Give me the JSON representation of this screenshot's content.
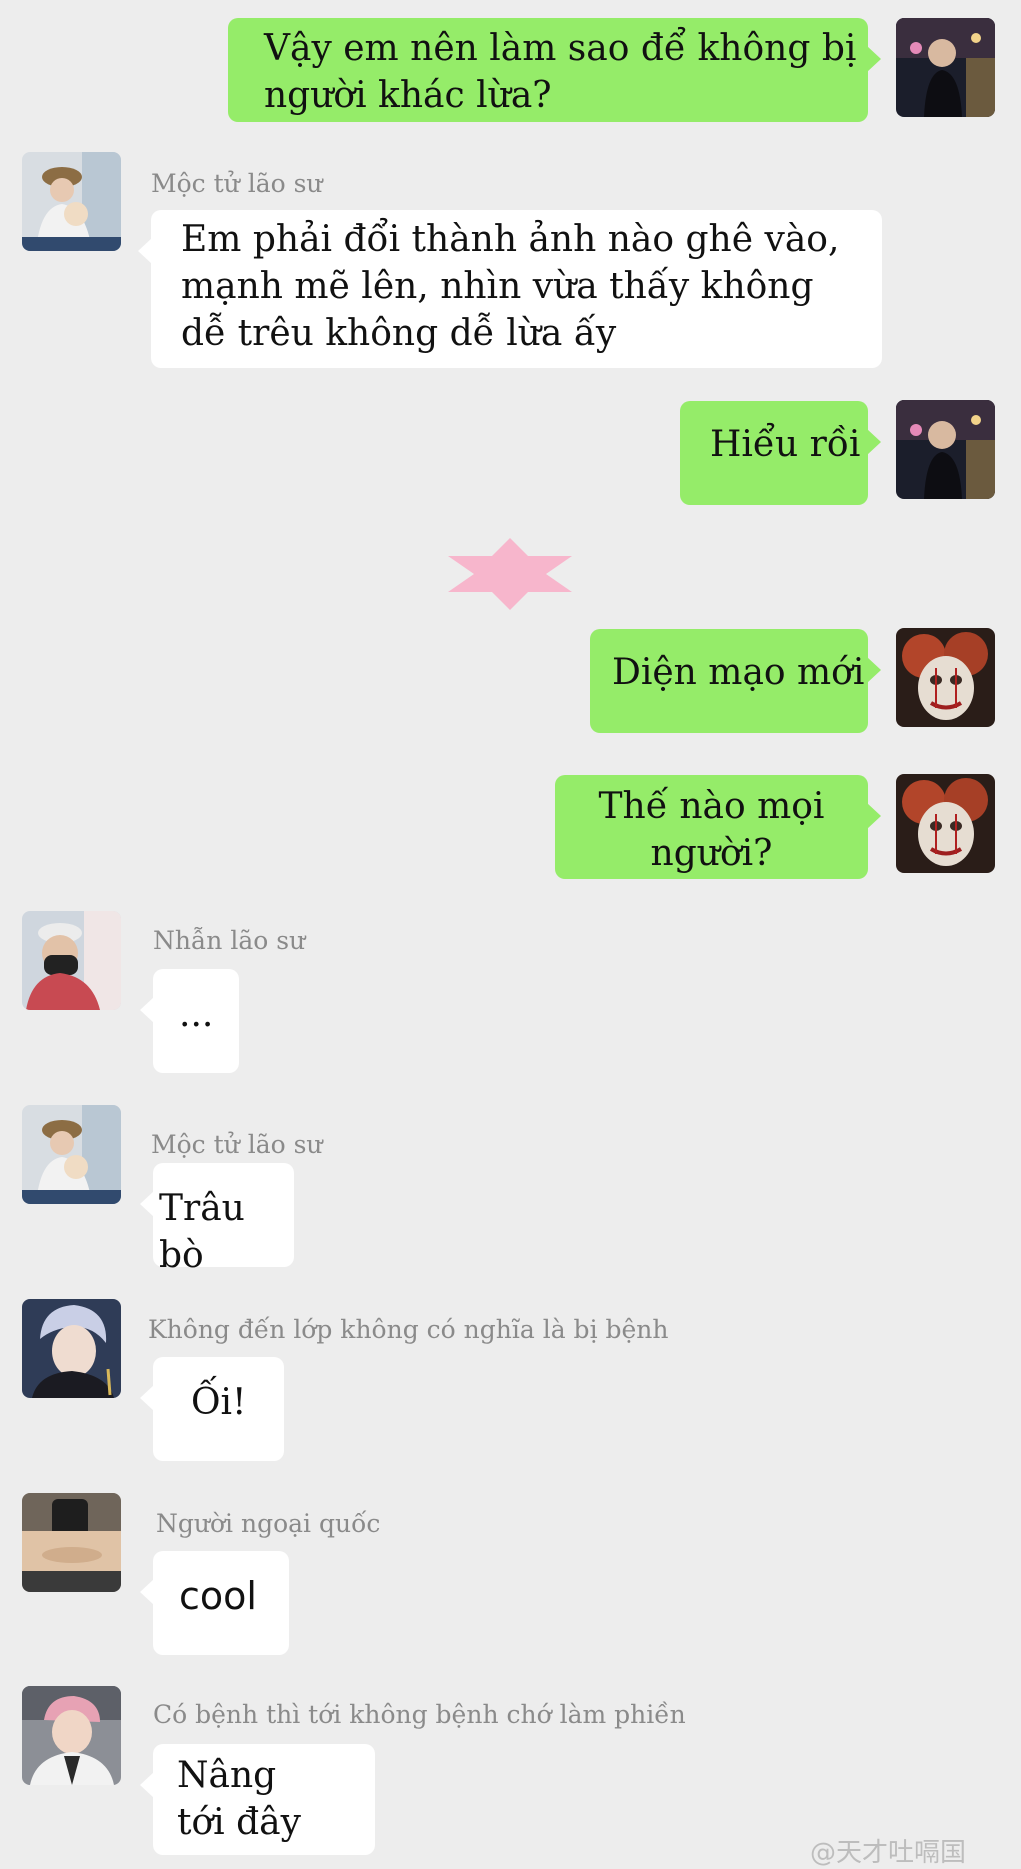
{
  "messages": [
    {
      "side": "me",
      "text": "Vậy em nên làm sao để không bị người khác lừa?"
    },
    {
      "side": "them",
      "sender": "Mộc tử lão sư",
      "text": "Em phải đổi thành ảnh nào ghê vào, mạnh mẽ lên, nhìn vừa thấy không dễ trêu không dễ lừa ấy"
    },
    {
      "side": "me",
      "text": "Hiểu rồi"
    },
    {
      "side": "me",
      "text": "Diện mạo mới"
    },
    {
      "side": "me",
      "text": "Thế nào mọi người?"
    },
    {
      "side": "them",
      "sender": "Nhẫn lão sư",
      "text": "..."
    },
    {
      "side": "them",
      "sender": "Mộc tử lão sư",
      "text": "Trâu bò"
    },
    {
      "side": "them",
      "sender": "Không đến lớp không có nghĩa là bị bệnh",
      "text": "Ối!"
    },
    {
      "side": "them",
      "sender": "Người ngoại quốc",
      "text": "cool"
    },
    {
      "side": "them",
      "sender": "Có bệnh thì tới không bệnh chớ làm phiền",
      "text": "Nâng tới đây"
    }
  ],
  "watermark": "@天才吐嗝国",
  "colors": {
    "background": "#ededed",
    "my_bubble": "#95ec69",
    "their_bubble": "#ffffff",
    "sender_name": "#8a8a8a",
    "divider_star": "#f7b6cc"
  },
  "icons": {
    "divider": "pink-star-icon",
    "avatars": [
      "photo-avatar",
      "clown-avatar"
    ]
  }
}
